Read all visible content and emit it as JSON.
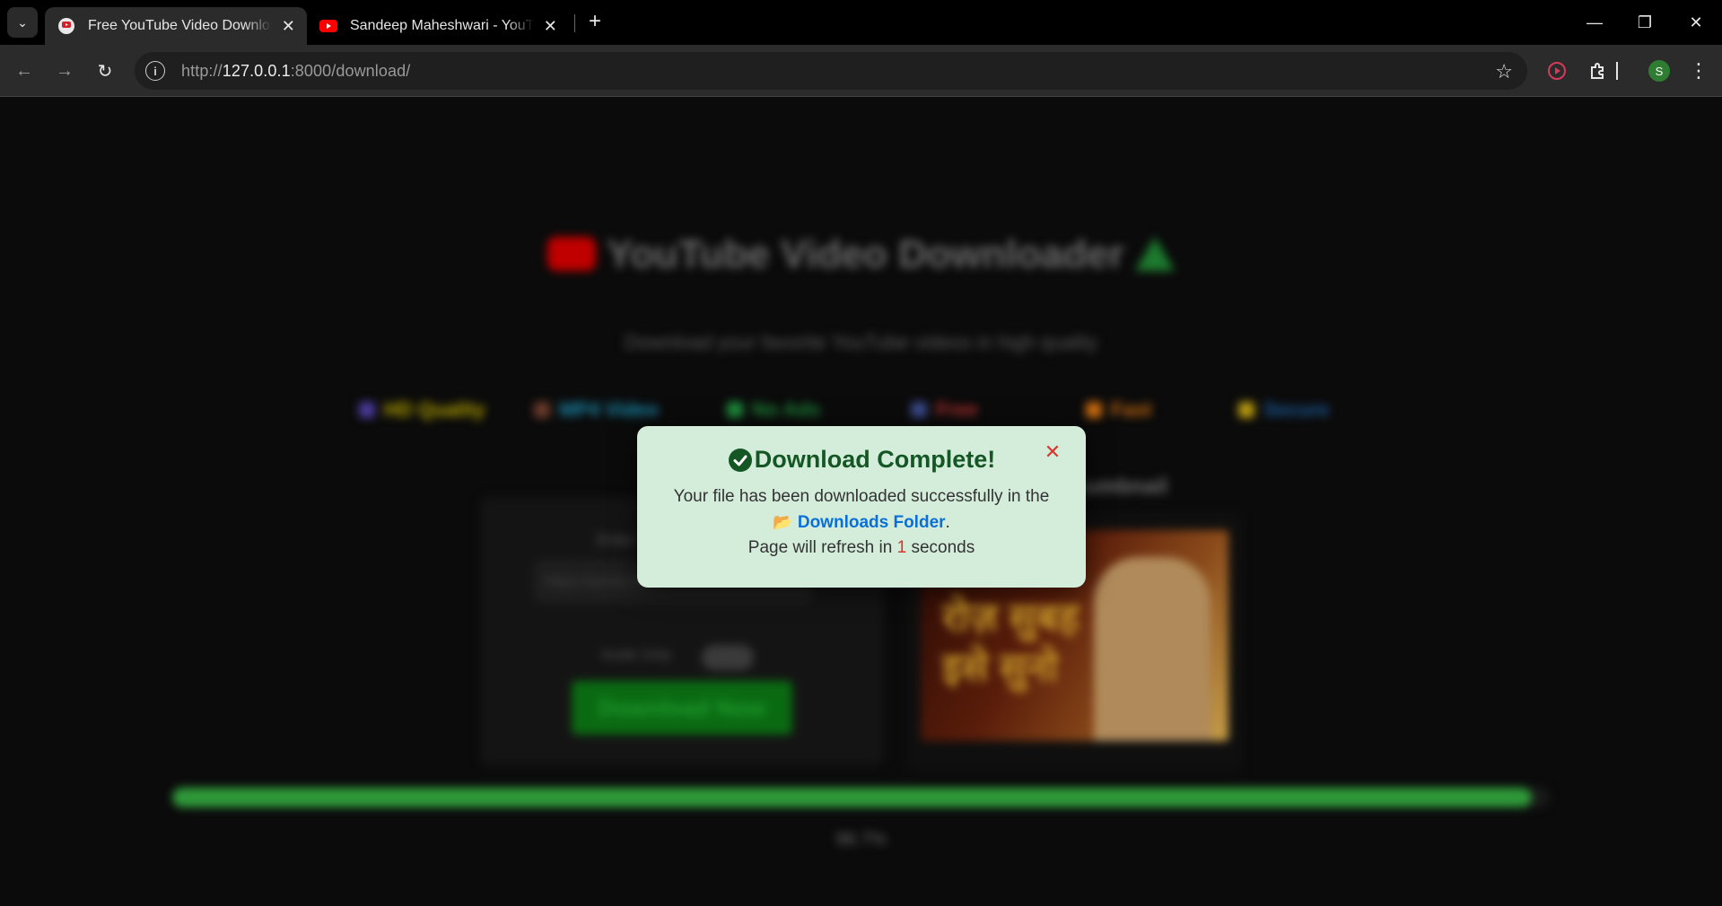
{
  "browser": {
    "tabs": [
      {
        "title": "Free YouTube Video Downloader",
        "active": true
      },
      {
        "title": "Sandeep Maheshwari - YouTube",
        "active": false
      }
    ],
    "url_scheme": "http://",
    "url_host": "127.0.0.1",
    "url_rest": ":8000/download/",
    "profile_initial": "S"
  },
  "page": {
    "hero_title": "YouTube Video Downloader",
    "hero_subtitle": "Download your favorite YouTube videos in high quality",
    "features": [
      {
        "label": "HD Quality",
        "color": "#b8a600"
      },
      {
        "label": "MP4 Video",
        "color": "#1a8cb0"
      },
      {
        "label": "No Ads",
        "color": "#1d8a3a"
      },
      {
        "label": "Free",
        "color": "#b83030"
      },
      {
        "label": "Fast",
        "color": "#c86a10"
      },
      {
        "label": "Secure",
        "color": "#1a5a9a"
      }
    ],
    "form": {
      "label": "Enter YouTube URL",
      "input_value": "https://youtu.be/...",
      "audio_only_label": "Audio Only",
      "download_button": "Download Now"
    },
    "thumbnail": {
      "label": "Thumbnail",
      "overlay_text_line1": "रोज़ सुबह",
      "overlay_text_line2": "इसे सुनो"
    },
    "progress": {
      "value": 98.7,
      "label": "98.7%"
    }
  },
  "modal": {
    "title": "Download Complete!",
    "body_prefix": "Your file has been downloaded successfully in the",
    "folder_link": "Downloads Folder",
    "body_suffix": ".",
    "refresh_prefix": "Page will refresh in",
    "refresh_count": "1",
    "refresh_suffix": "seconds",
    "close_symbol": "✕",
    "accent_color": "#155724",
    "link_color": "#0a6fd8"
  }
}
